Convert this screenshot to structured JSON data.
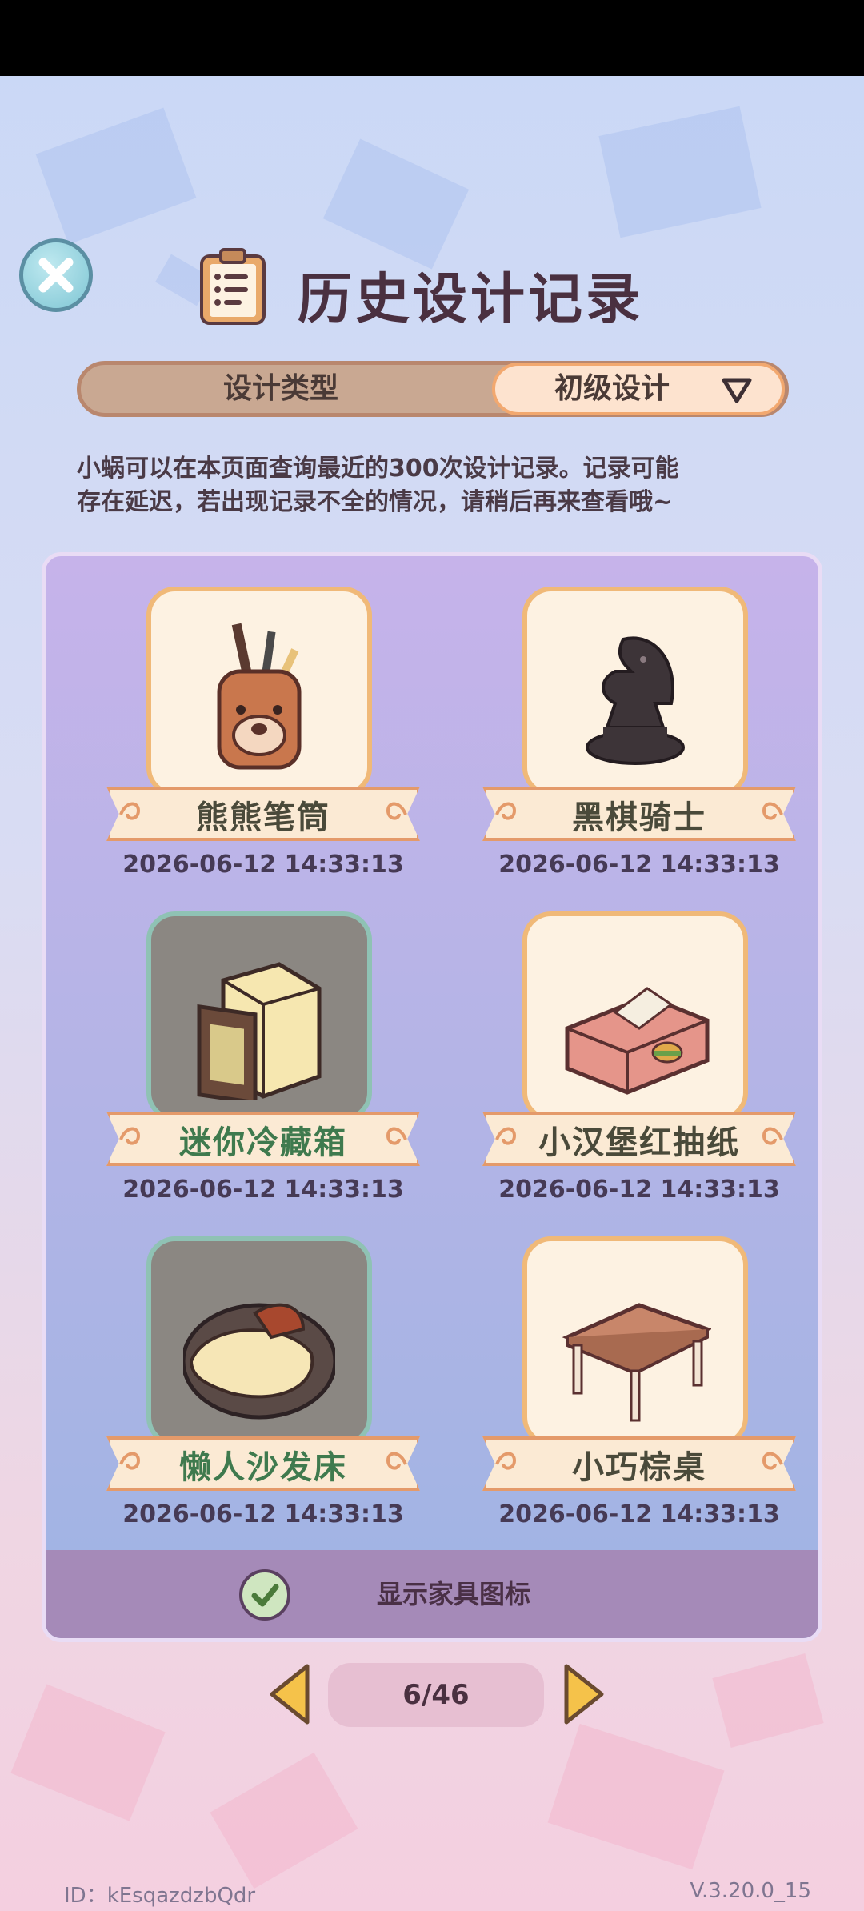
{
  "header": {
    "title": "历史设计记录",
    "title_icon": "clipboard-icon",
    "close_icon": "close-icon"
  },
  "filter": {
    "type_label": "设计类型",
    "selected": "初级设计",
    "dropdown_icon": "triangle-down-icon"
  },
  "notice": {
    "line1": "小蜗可以在本页面查询最近的300次设计记录。记录可能",
    "line2": "存在延迟，若出现记录不全的情况，请稍后再来查看哦~"
  },
  "items": [
    {
      "name": "熊熊笔筒",
      "date": "2026-06-12 14:33:13",
      "icon": "bear-pencil-holder-icon"
    },
    {
      "name": "黑棋骑士",
      "date": "2026-06-12 14:33:13",
      "icon": "chess-knight-icon"
    },
    {
      "name": "迷你冷藏箱",
      "date": "2026-06-12 14:33:13",
      "icon": "mini-fridge-icon"
    },
    {
      "name": "小汉堡红抽纸",
      "date": "2026-06-12 14:33:13",
      "icon": "tissue-box-icon"
    },
    {
      "name": "懒人沙发床",
      "date": "2026-06-12 14:33:13",
      "icon": "bean-bag-sofa-icon"
    },
    {
      "name": "小巧棕桌",
      "date": "2026-06-12 14:33:13",
      "icon": "brown-table-icon"
    }
  ],
  "footer_toggle": {
    "label": "显示家具图标",
    "checked": true
  },
  "pager": {
    "text": "6/46"
  },
  "bottom": {
    "id_text": "ID：kEsqazdzbQdr",
    "version": "V.3.20.0_15"
  },
  "colors": {
    "ribbon_border": "#e49a6a",
    "card_border": "#f0b978",
    "green_label": "#3f7a4e",
    "panel_footer": "#a58ab8"
  }
}
